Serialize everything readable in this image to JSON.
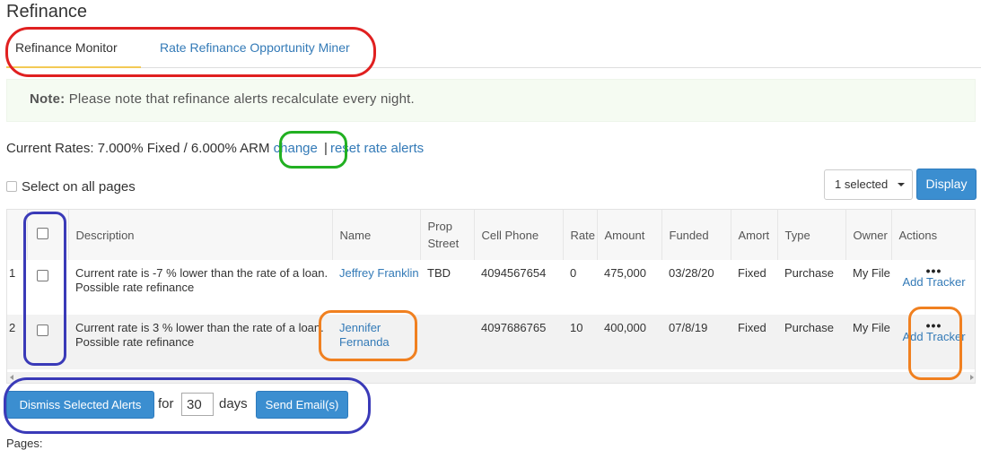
{
  "page": {
    "title": "Refinance"
  },
  "tabs": [
    {
      "label": "Refinance Monitor",
      "active": true
    },
    {
      "label": "Rate Refinance Opportunity Miner",
      "active": false
    }
  ],
  "note": {
    "label": "Note:",
    "text": "Please note that refinance alerts recalculate every night."
  },
  "rates": {
    "text": "Current Rates: 7.000% Fixed / 6.000% ARM",
    "change_link": "change",
    "separator": "|",
    "reset_link": "reset rate alerts"
  },
  "select_all_label": "Select on all pages",
  "toolbar": {
    "selected_dropdown": "1 selected",
    "display_button": "Display"
  },
  "table": {
    "headers": [
      "Description",
      "Name",
      "Prop Street",
      "Cell Phone",
      "Rate",
      "Amount",
      "Funded",
      "Amort",
      "Type",
      "Owner",
      "Actions"
    ],
    "rows": [
      {
        "index": "1",
        "description": "Current rate is -7 % lower than the rate of a loan. Possible rate refinance",
        "name": "Jeffrey Franklin",
        "street": "TBD",
        "phone": "4094567654",
        "rate": "0",
        "amount": "475,000",
        "funded": "03/28/20",
        "amort": "Fixed",
        "type": "Purchase",
        "owner": "My File",
        "dots": "•••",
        "action": "Add Tracker"
      },
      {
        "index": "2",
        "description": "Current rate is 3 % lower than the rate of a loan. Possible rate refinance",
        "name": "Jennifer Fernanda",
        "street": "",
        "phone": "4097686765",
        "rate": "10",
        "amount": "400,000",
        "funded": "07/8/19",
        "amort": "Fixed",
        "type": "Purchase",
        "owner": "My File",
        "dots": "•••",
        "action": "Add Tracker"
      }
    ]
  },
  "footer": {
    "dismiss_button": "Dismiss Selected Alerts",
    "for_label": "for",
    "days_value": "30",
    "days_label": "days",
    "send_email_button": "Send Email(s)",
    "pages_label": "Pages:"
  },
  "colors": {
    "accent": "#3b8ed0",
    "link": "#337ab7",
    "tab_underline": "#f3ca55",
    "note_bg": "#f5fbf2",
    "annotation_red": "#e02020",
    "annotation_green": "#22b022",
    "annotation_blue": "#3a3ab8",
    "annotation_orange": "#f08020"
  }
}
